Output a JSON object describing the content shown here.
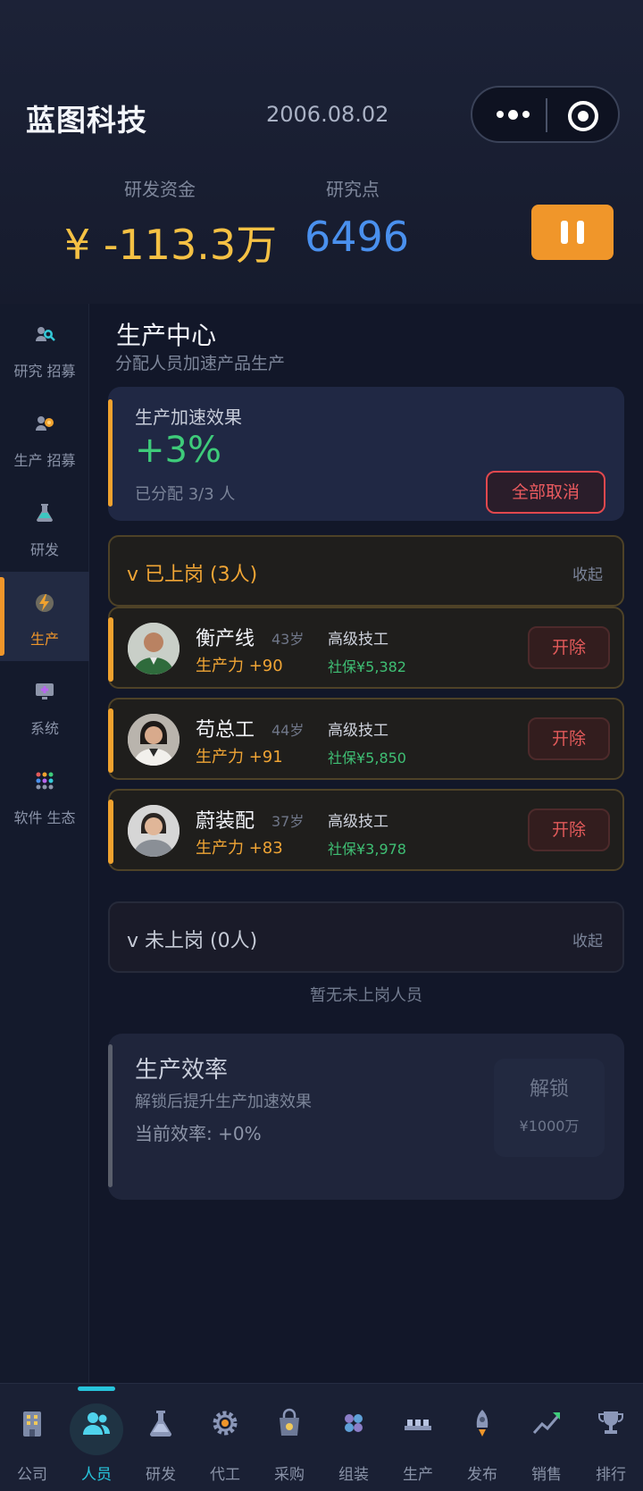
{
  "header": {
    "company": "蓝图科技",
    "date": "2006.08.02",
    "funds_label": "研发资金",
    "funds_value": "¥ -113.3万",
    "points_label": "研究点",
    "points_value": "6496"
  },
  "sidebar": {
    "items": [
      {
        "label": "研究 招募",
        "icon": "research-recruit-icon"
      },
      {
        "label": "生产 招募",
        "icon": "production-recruit-icon"
      },
      {
        "label": "研发",
        "icon": "flask-icon"
      },
      {
        "label": "生产",
        "icon": "lightning-icon"
      },
      {
        "label": "系统",
        "icon": "monitor-icon"
      },
      {
        "label": "软件 生态",
        "icon": "apps-grid-icon"
      }
    ]
  },
  "main": {
    "title": "生产中心",
    "subtitle": "分配人员加速产品生产",
    "boost": {
      "title": "生产加速效果",
      "value": "+3%",
      "assigned": "已分配 3/3 人",
      "cancel_all": "全部取消"
    },
    "on_duty": {
      "title": "v 已上岗 (3人)",
      "collapse": "收起",
      "workers": [
        {
          "name": "衡产线",
          "age": "43岁",
          "title": "高级技工",
          "productivity": "生产力 +90",
          "insurance": "社保¥5,382",
          "fire": "开除"
        },
        {
          "name": "苟总工",
          "age": "44岁",
          "title": "高级技工",
          "productivity": "生产力 +91",
          "insurance": "社保¥5,850",
          "fire": "开除"
        },
        {
          "name": "蔚装配",
          "age": "37岁",
          "title": "高级技工",
          "productivity": "生产力 +83",
          "insurance": "社保¥3,978",
          "fire": "开除"
        }
      ]
    },
    "off_duty": {
      "title": "v 未上岗 (0人)",
      "collapse": "收起",
      "empty": "暂无未上岗人员"
    },
    "efficiency": {
      "title": "生产效率",
      "desc": "解锁后提升生产加速效果",
      "current": "当前效率: +0%",
      "unlock": "解锁",
      "cost": "¥1000万"
    }
  },
  "bottom_nav": {
    "items": [
      {
        "label": "公司",
        "icon": "building-icon"
      },
      {
        "label": "人员",
        "icon": "people-icon"
      },
      {
        "label": "研发",
        "icon": "flask-icon"
      },
      {
        "label": "代工",
        "icon": "gear-icon"
      },
      {
        "label": "采购",
        "icon": "shopping-bag-icon"
      },
      {
        "label": "组装",
        "icon": "components-icon"
      },
      {
        "label": "生产",
        "icon": "production-line-icon"
      },
      {
        "label": "发布",
        "icon": "rocket-icon"
      },
      {
        "label": "销售",
        "icon": "trend-chart-icon"
      },
      {
        "label": "排行",
        "icon": "trophy-icon"
      }
    ]
  },
  "colors": {
    "accent_orange": "#f0962a",
    "funds_yellow": "#f5c144",
    "points_blue": "#4a90ee",
    "positive_green": "#3ecb7a",
    "danger_red": "#e1484e",
    "nav_active_cyan": "#27c4dc"
  }
}
